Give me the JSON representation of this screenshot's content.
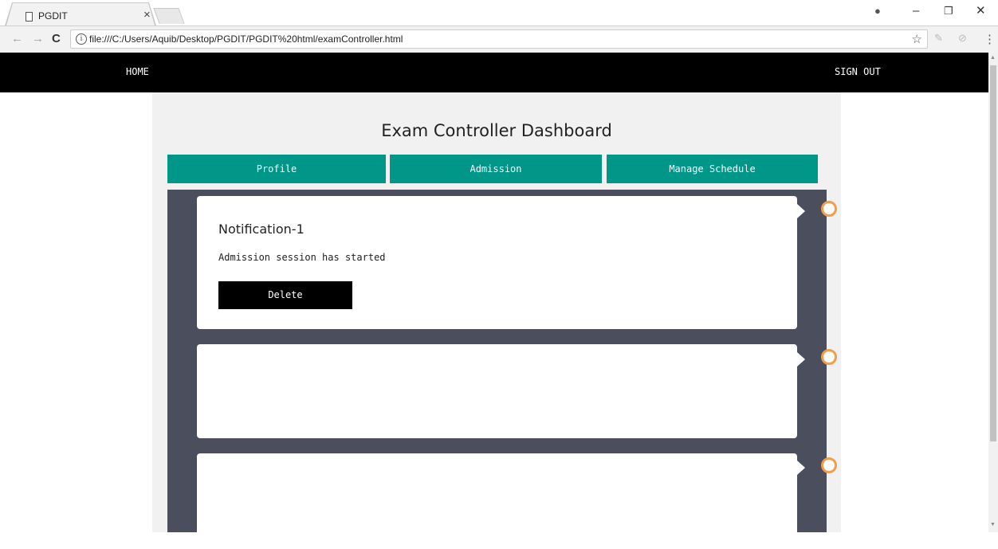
{
  "browser": {
    "tab_title": "PGDIT",
    "tab_close": "×",
    "url": "file:///C:/Users/Aquib/Desktop/PGDIT/PGDIT%20html/examController.html",
    "info_glyph": "i",
    "back_glyph": "←",
    "forward_glyph": "→",
    "reload_glyph": "C",
    "star_glyph": "☆",
    "menu_glyph": "⋮",
    "minimize_glyph": "–",
    "restore_glyph": "❐",
    "close_glyph": "✕",
    "account_glyph": "●"
  },
  "nav": {
    "home": "HOME",
    "sign_out": "SIGN OUT"
  },
  "dashboard": {
    "title": "Exam Controller Dashboard",
    "buttons": [
      "Profile",
      "Admission",
      "Manage Schedule"
    ]
  },
  "notifications": [
    {
      "title": "Notification-1",
      "text": "Admission session has started",
      "delete_label": "Delete"
    }
  ],
  "colors": {
    "nav_bg": "#000000",
    "button_teal": "#009688",
    "timeline_bg": "#4a4e5d",
    "dot_orange": "#f39c4a"
  }
}
